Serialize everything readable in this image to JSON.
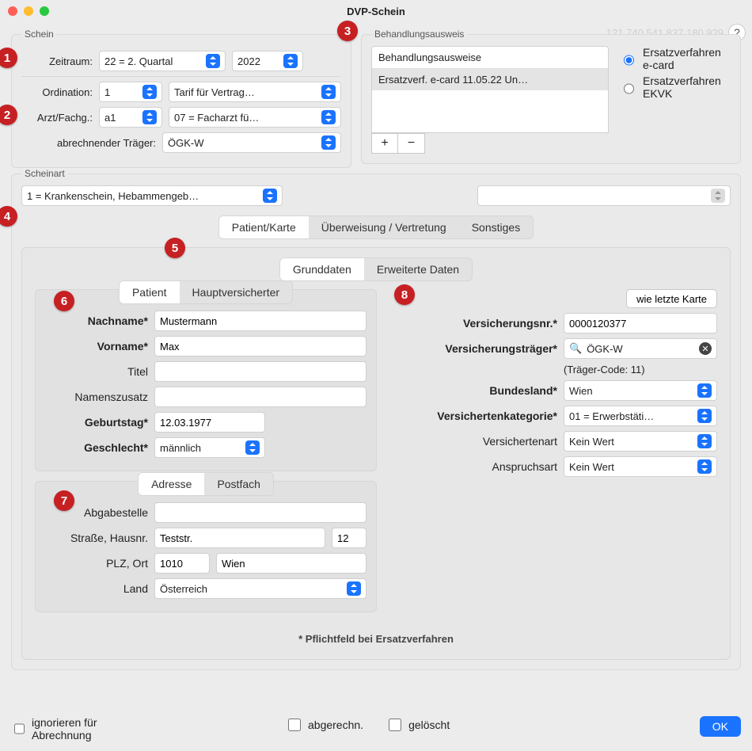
{
  "window": {
    "title": "DVP-Schein",
    "id_string": "121.740.541.837.180.929",
    "help": "?"
  },
  "callouts": {
    "1": "1",
    "2": "2",
    "3": "3",
    "4": "4",
    "5": "5",
    "6": "6",
    "7": "7",
    "8": "8"
  },
  "schein": {
    "legend": "Schein",
    "zeitraum_lbl": "Zeitraum:",
    "zeitraum_val": "22 = 2. Quartal",
    "zeitraum_year": "2022",
    "ordination_lbl": "Ordination:",
    "ordination_val": "1",
    "ordination_tarif": "Tarif für Vertrag…",
    "arzt_lbl": "Arzt/Fachg.:",
    "arzt_val": "a1",
    "arzt_fach": "07 = Facharzt fü…",
    "traeger_lbl": "abrechnender Träger:",
    "traeger_val": "ÖGK-W"
  },
  "beh": {
    "legend": "Behandlungsausweis",
    "list_header": "Behandlungsausweise",
    "list_item1": "Ersatzverf. e-card 11.05.22 Un…",
    "add": "+",
    "remove": "−",
    "radio1": "Ersatzverfahren e-card",
    "radio2": "Ersatzverfahren EKVK"
  },
  "scheinart": {
    "legend": "Scheinart",
    "value": "1 = Krankenschein, Hebammengeb…"
  },
  "tabs_main": {
    "t1": "Patient/Karte",
    "t2": "Überweisung / Vertretung",
    "t3": "Sonstiges"
  },
  "tabs_sub": {
    "t1": "Grunddaten",
    "t2": "Erweiterte Daten"
  },
  "patient_tabs": {
    "t1": "Patient",
    "t2": "Hauptversicherter"
  },
  "patient": {
    "nachname_lbl": "Nachname*",
    "nachname_val": "Mustermann",
    "vorname_lbl": "Vorname*",
    "vorname_val": "Max",
    "titel_lbl": "Titel",
    "titel_val": "",
    "zusatz_lbl": "Namenszusatz",
    "zusatz_val": "",
    "geb_lbl": "Geburtstag*",
    "geb_val": "12.03.1977",
    "geschl_lbl": "Geschlecht*",
    "geschl_val": "männlich"
  },
  "addr_tabs": {
    "t1": "Adresse",
    "t2": "Postfach"
  },
  "addr": {
    "abgabe_lbl": "Abgabestelle",
    "abgabe_val": "",
    "strasse_lbl": "Straße, Hausnr.",
    "strasse_val": "Teststr.",
    "hausnr_val": "12",
    "plz_lbl": "PLZ, Ort",
    "plz_val": "1010",
    "ort_val": "Wien",
    "land_lbl": "Land",
    "land_val": "Österreich"
  },
  "ins": {
    "btn_last": "wie letzte Karte",
    "nr_lbl": "Versicherungsnr.*",
    "nr_val": "0000120377",
    "traeger_lbl": "Versicherungsträger*",
    "traeger_val": "ÖGK-W",
    "traeger_code": "(Träger-Code: 11)",
    "bundesland_lbl": "Bundesland*",
    "bundesland_val": "Wien",
    "kat_lbl": "Versichertenkategorie*",
    "kat_val": "01 = Erwerbstäti…",
    "art_lbl": "Versichertenart",
    "art_val": "Kein Wert",
    "anspruch_lbl": "Anspruchsart",
    "anspruch_val": "Kein Wert",
    "pflicht": "* Pflichtfeld bei Ersatzverfahren"
  },
  "footer": {
    "ignore": "ignorieren für Abrechnung",
    "abger": "abgerechn.",
    "geloescht": "gelöscht",
    "ok": "OK"
  }
}
